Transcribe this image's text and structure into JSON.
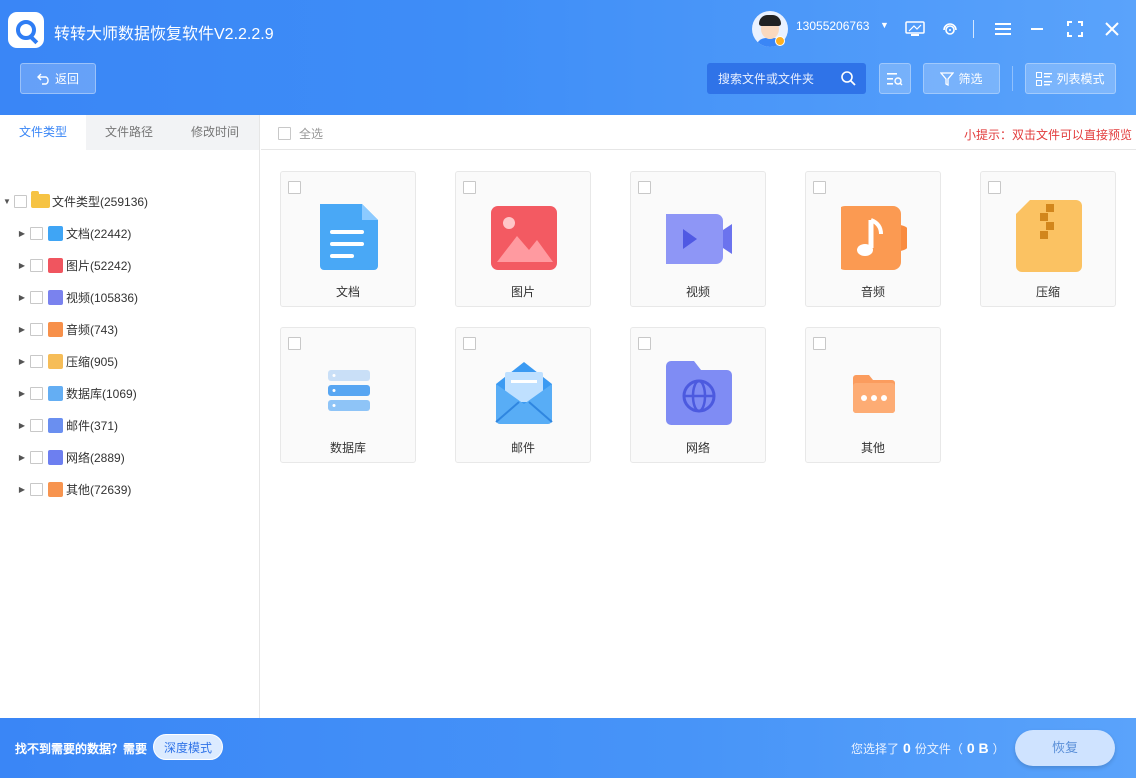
{
  "app": {
    "title": "转转大师数据恢复软件V2.2.2.9",
    "account": "13055206763"
  },
  "toolbar": {
    "back_label": "返回",
    "search_placeholder": "搜索文件或文件夹",
    "filter_label": "筛选",
    "view_label": "列表模式"
  },
  "left_panel": {
    "tabs": [
      {
        "label": "文件类型",
        "active": true
      },
      {
        "label": "文件路径",
        "active": false
      },
      {
        "label": "修改时间",
        "active": false
      }
    ],
    "tree_root": "文件类型(259136)",
    "tree_items": [
      {
        "label": "文档(22442)",
        "icon": "document-icon",
        "color": "#3fa5f5"
      },
      {
        "label": "图片(52242)",
        "icon": "image-icon",
        "color": "#f0555f"
      },
      {
        "label": "视频(105836)",
        "icon": "video-icon",
        "color": "#7a82ee"
      },
      {
        "label": "音频(743)",
        "icon": "audio-icon",
        "color": "#f7904a"
      },
      {
        "label": "压缩(905)",
        "icon": "archive-icon",
        "color": "#f6bd58"
      },
      {
        "label": "数据库(1069)",
        "icon": "database-icon",
        "color": "#64aef3"
      },
      {
        "label": "邮件(371)",
        "icon": "mail-icon",
        "color": "#6a8ff0"
      },
      {
        "label": "网络(2889)",
        "icon": "network-icon",
        "color": "#6d7ff0"
      },
      {
        "label": "其他(72639)",
        "icon": "other-icon",
        "color": "#f7944f"
      }
    ]
  },
  "main": {
    "select_all_label": "全选",
    "tip": "小提示：双击文件可以直接预览",
    "cards": [
      {
        "label": "文档",
        "icon": "document-icon"
      },
      {
        "label": "图片",
        "icon": "image-icon"
      },
      {
        "label": "视频",
        "icon": "video-icon"
      },
      {
        "label": "音频",
        "icon": "audio-icon"
      },
      {
        "label": "压缩",
        "icon": "archive-icon"
      },
      {
        "label": "数据库",
        "icon": "database-icon"
      },
      {
        "label": "邮件",
        "icon": "mail-icon"
      },
      {
        "label": "网络",
        "icon": "network-icon"
      },
      {
        "label": "其他",
        "icon": "other-icon"
      }
    ]
  },
  "footer": {
    "hint_text": "找不到需要的数据？需要",
    "deep_mode_label": "深度模式",
    "selected_prefix": "您选择了",
    "selected_count": "0",
    "selected_unit": "份文件（",
    "selected_size": "0 B",
    "selected_suffix": "）",
    "recover_label": "恢复"
  },
  "colors": {
    "header_blue": "#3a86f6",
    "tab_active": "#3a86f6",
    "tip_red": "#e23b3b"
  }
}
